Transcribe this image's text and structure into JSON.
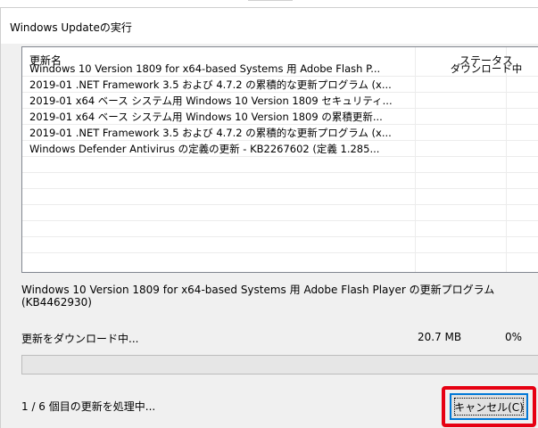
{
  "window": {
    "title": "Windows Updateの実行"
  },
  "list": {
    "columns": {
      "name": "更新名",
      "status": "ステータス"
    },
    "rows": [
      {
        "name": "Windows 10 Version 1809 for x64-based Systems 用 Adobe Flash P...",
        "status": "ダウンロード中"
      },
      {
        "name": "2019-01 .NET Framework 3.5 および 4.7.2 の累積的な更新プログラム (x...",
        "status": ""
      },
      {
        "name": "2019-01 x64 ベース システム用 Windows 10 Version 1809 セキュリティ...",
        "status": ""
      },
      {
        "name": "2019-01 x64 ベース システム用 Windows 10 Version 1809 の累積更新...",
        "status": ""
      },
      {
        "name": "2019-01 .NET Framework 3.5 および 4.7.2 の累積的な更新プログラム (x...",
        "status": ""
      },
      {
        "name": "Windows Defender Antivirus の定義の更新 - KB2267602 (定義 1.285...",
        "status": ""
      }
    ]
  },
  "current_update": {
    "description": "Windows 10 Version 1809 for x64-based Systems 用 Adobe Flash Player の更新プログラム (KB4462930)",
    "status_text": "更新をダウンロード中...",
    "size": "20.7 MB",
    "percent": "0%",
    "progress": 0
  },
  "counter": "1 / 6 個目の更新を処理中...",
  "buttons": {
    "cancel": "キャンセル(C)"
  },
  "colors": {
    "highlight": "#e60012",
    "focus_border": "#0078d7",
    "progress_fill": "#06b025"
  }
}
